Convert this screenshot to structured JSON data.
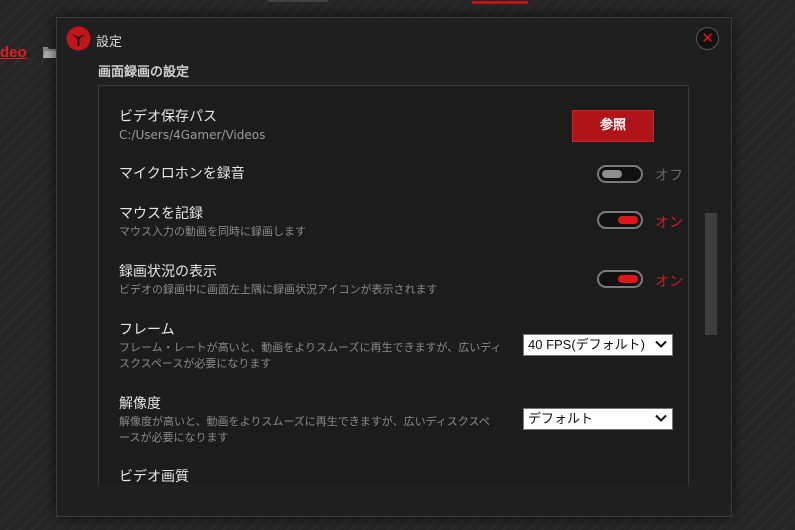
{
  "background": {
    "link_text": "deo"
  },
  "dialog": {
    "title": "設定",
    "close_glyph": "✕",
    "section_title": "画面録画の設定"
  },
  "settings": {
    "video_path": {
      "label": "ビデオ保存パス",
      "value": "C:/Users/4Gamer/Videos",
      "button_label": "参照"
    },
    "mic_record": {
      "label": "マイクロホンを録音",
      "state": "オフ",
      "enabled": false
    },
    "mouse_record": {
      "label": "マウスを記録",
      "description": "マウス入力の動画を同時に録画します",
      "state": "オン",
      "enabled": true
    },
    "record_status": {
      "label": "録画状況の表示",
      "description": "ビデオの録画中に画面左上隅に録画状況アイコンが表示されます",
      "state": "オン",
      "enabled": true
    },
    "frame": {
      "label": "フレーム",
      "description": "フレーム・レートが高いと、動画をよりスムーズに再生できますが、広いディスクスペースが必要になります",
      "selected": "40 FPS(デフォルト)"
    },
    "resolution": {
      "label": "解像度",
      "description": "解像度が高いと、動画をよりスムーズに再生できますが、広いディスクスペースが必要になります",
      "selected": "デフォルト"
    },
    "video_quality": {
      "label": "ビデオ画質"
    }
  },
  "colors": {
    "accent": "#e0141b",
    "button": "#b01419",
    "background": "#262626",
    "dialog": "#1f1f1f"
  },
  "icons": [
    "app-logo-icon",
    "close-icon",
    "folder-icon",
    "chevron-down-icon"
  ]
}
